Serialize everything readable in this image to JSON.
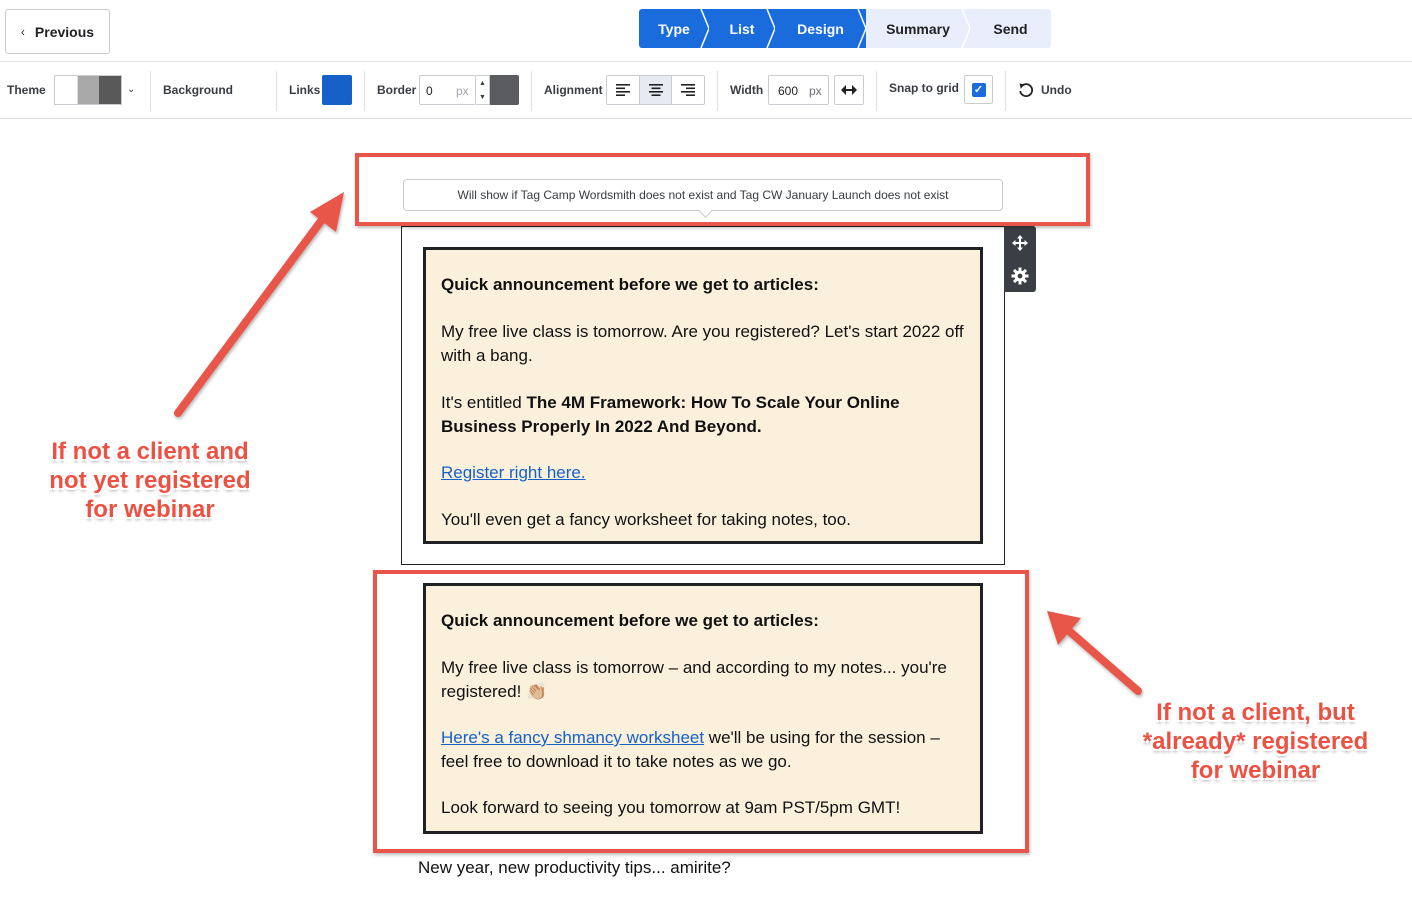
{
  "nav": {
    "previous_label": "Previous",
    "previous_chevron": "‹",
    "steps": [
      {
        "label": "Type",
        "state": "active"
      },
      {
        "label": "List",
        "state": "active"
      },
      {
        "label": "Design",
        "state": "active"
      },
      {
        "label": "Summary",
        "state": "inactive"
      },
      {
        "label": "Send",
        "state": "inactive"
      }
    ]
  },
  "toolbar": {
    "theme_label": "Theme",
    "theme_colors": [
      "#ffffff",
      "#a8a8a8",
      "#595959"
    ],
    "background_label": "Background",
    "links_label": "Links",
    "links_color": "#1660c9",
    "border_label": "Border",
    "border_value": "0",
    "border_unit": "px",
    "border_color": "#5a5c60",
    "alignment_label": "Alignment",
    "alignment_selected": "center",
    "width_label": "Width",
    "width_value": "600",
    "width_unit": "px",
    "snap_label": "Snap to grid",
    "snap_checked": true,
    "undo_label": "Undo"
  },
  "canvas": {
    "condition_tooltip": "Will show if Tag Camp Wordsmith does not exist and Tag CW January Launch does not exist",
    "block1": {
      "heading": "Quick announcement before we get to articles:",
      "para1": "My free live class is tomorrow. Are you registered? Let's start 2022 off with a bang.",
      "para2_prefix": "It's entitled ",
      "para2_bold": "The 4M Framework: How To Scale Your Online Business Properly In 2022 And Beyond.",
      "link": "Register right here.",
      "para3": "You'll even get a fancy worksheet for taking notes, too."
    },
    "block2": {
      "heading": "Quick announcement before we get to articles:",
      "para1": "My free live class is tomorrow – and according to my notes... you're registered! 👏🏼",
      "link": "Here's a fancy shmancy worksheet",
      "para2_suffix": " we'll be using for the session – feel free to download it to take notes as we go.",
      "para3": "Look forward to seeing you tomorrow at 9am PST/5pm GMT!"
    },
    "tail_text": "New year, new productivity tips... amirite?"
  },
  "annotations": {
    "left_note": "If not a client and not yet registered for webinar",
    "right_note": "If not a client, but *already* registered for webinar",
    "color": "#e8554a"
  }
}
